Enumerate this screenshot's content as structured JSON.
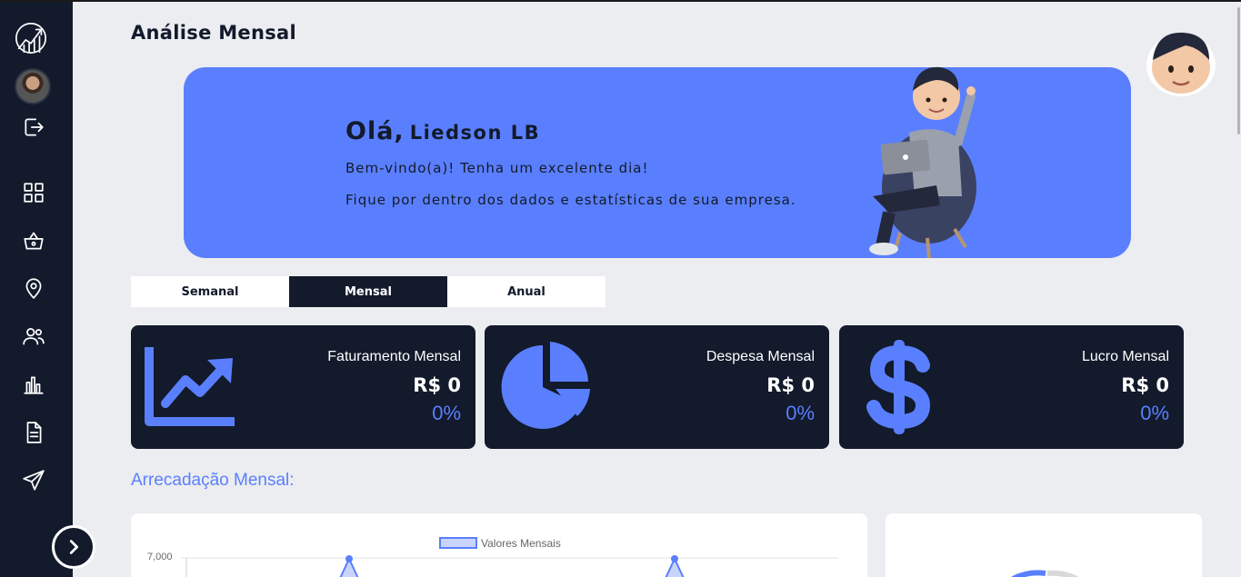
{
  "page": {
    "title": "Análise Mensal"
  },
  "sidebar": {
    "items": [
      {
        "name": "logo",
        "icon": "chart-logo-icon"
      },
      {
        "name": "logout",
        "icon": "logout-icon"
      },
      {
        "name": "dashboard",
        "icon": "grid-icon"
      },
      {
        "name": "products",
        "icon": "basket-icon"
      },
      {
        "name": "locations",
        "icon": "map-pin-icon"
      },
      {
        "name": "users",
        "icon": "users-icon"
      },
      {
        "name": "reports",
        "icon": "bar-chart-icon"
      },
      {
        "name": "documents",
        "icon": "document-icon"
      },
      {
        "name": "send",
        "icon": "send-icon"
      }
    ],
    "expand_icon": "chevron-right-icon"
  },
  "banner": {
    "greeting": "Olá,",
    "user_name": "Liedson LB",
    "welcome": "Bem-vindo(a)! Tenha um excelente dia!",
    "subtitle": "Fique por dentro dos dados e estatísticas de sua empresa."
  },
  "tabs": [
    {
      "label": "Semanal",
      "active": false
    },
    {
      "label": "Mensal",
      "active": true
    },
    {
      "label": "Anual",
      "active": false
    }
  ],
  "cards": [
    {
      "label": "Faturamento Mensal",
      "value": "R$ 0",
      "percent": "0%",
      "icon": "trending-up-icon"
    },
    {
      "label": "Despesa Mensal",
      "value": "R$ 0",
      "percent": "0%",
      "icon": "pie-chart-icon"
    },
    {
      "label": "Lucro Mensal",
      "value": "R$ 0",
      "percent": "0%",
      "icon": "dollar-icon"
    }
  ],
  "section": {
    "title": "Arrecadação Mensal:"
  },
  "chart": {
    "legend": "Valores Mensais",
    "y_tick_top": "7,000"
  },
  "colors": {
    "accent": "#5a7ffe",
    "dark": "#121a2b",
    "background": "#ecedf1"
  }
}
